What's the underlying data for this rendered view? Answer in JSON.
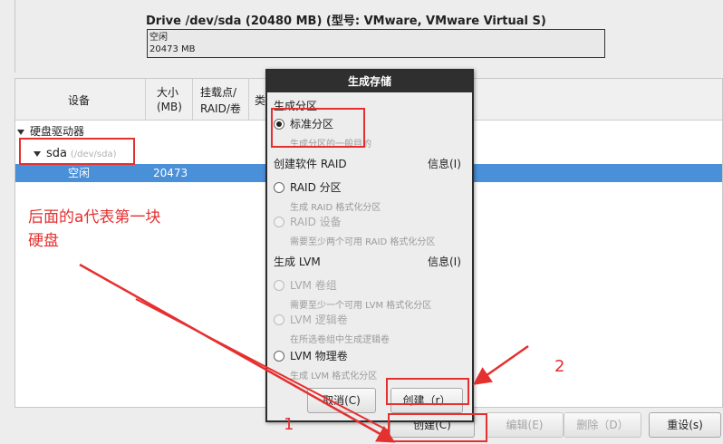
{
  "drive": {
    "title": "Drive /dev/sda (20480 MB) (型号: VMware, VMware Virtual S)",
    "segment_label": "空闲",
    "segment_size": "20473 MB"
  },
  "columns": {
    "device": "设备",
    "size_line1": "大小",
    "size_line2": "(MB)",
    "mount_line1": "挂载点/",
    "mount_line2": "RAID/卷",
    "type_partial": "类"
  },
  "tree": {
    "group_label": "硬盘驱动器",
    "disk_name": "sda",
    "disk_path": "(/dev/sda)",
    "free_label": "空闲",
    "free_size": "20473"
  },
  "buttons": {
    "create": "创建(C)",
    "edit": "编辑(E)",
    "delete": "删除（D）",
    "reset": "重设(s)"
  },
  "dialog": {
    "title": "生成存储",
    "section_partition": "生成分区",
    "opt_standard": "标准分区",
    "opt_standard_hint": "生成分区的一般目的",
    "section_raid": "创建软件 RAID",
    "info": "信息(I)",
    "opt_raid_partition": "RAID 分区",
    "opt_raid_partition_hint": "生成 RAID 格式化分区",
    "opt_raid_device": "RAID 设备",
    "opt_raid_device_hint": "需要至少两个可用 RAID 格式化分区",
    "section_lvm": "生成 LVM",
    "opt_lvm_vg": "LVM 卷组",
    "opt_lvm_vg_hint": "需要至少一个可用 LVM 格式化分区",
    "opt_lvm_lv": "LVM 逻辑卷",
    "opt_lvm_lv_hint": "在所选卷组中生成逻辑卷",
    "opt_lvm_pv": "LVM 物理卷",
    "opt_lvm_pv_hint": "生成 LVM 格式化分区",
    "cancel": "取消(C)",
    "create": "创建（r）"
  },
  "annotations": {
    "note_line1": "后面的a代表第一块",
    "note_line2": "硬盘",
    "num1": "1",
    "num2": "2",
    "color": "#e53030"
  }
}
